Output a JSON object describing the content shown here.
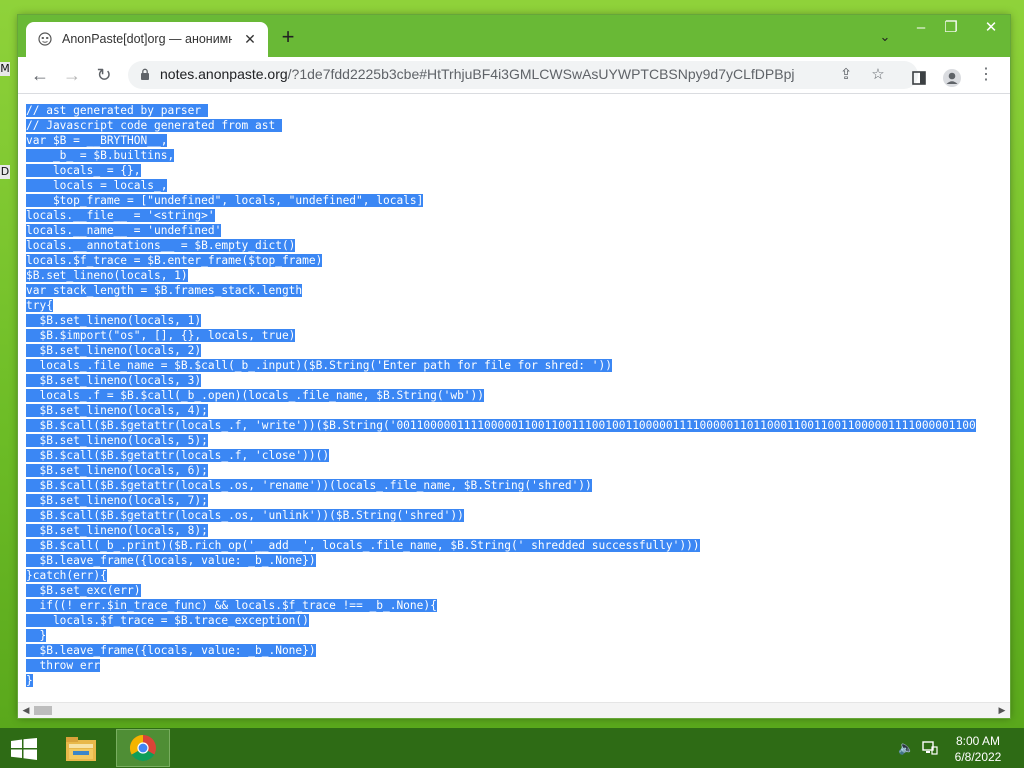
{
  "browser": {
    "tab_title": "AnonPaste[dot]org — анонимн",
    "url_host": "notes.anonpaste.org",
    "url_path": "/?1de7fdd2225b3cbe#HtTrhjuBF4i3GMLCWSwAsUYWPTCBSNpy9d7yCLfDPBpj",
    "icons": {
      "tab_favicon": "anonpaste-mask-icon",
      "tab_close": "close-icon",
      "new_tab": "plus-icon",
      "tab_search": "chevron-down-icon",
      "back": "arrow-left-icon",
      "forward": "arrow-right-icon",
      "reload": "reload-icon",
      "lock": "lock-icon",
      "share": "share-icon",
      "bookmark": "star-icon",
      "side_panel": "side-panel-icon",
      "profile": "profile-icon",
      "menu": "kebab-menu-icon"
    }
  },
  "desktop": {
    "edge_labels": [
      "M",
      "D"
    ]
  },
  "code_lines": [
    "// ast generated by parser ",
    "// Javascript code generated from ast ",
    "var $B = __BRYTHON__,",
    "    _b_ = $B.builtins,",
    "    locals_ = {},",
    "    locals = locals_,",
    "    $top_frame = [\"undefined\", locals, \"undefined\", locals]",
    "locals.__file__ = '<string>'",
    "locals.__name__ = 'undefined'",
    "locals.__annotations__ = $B.empty_dict()",
    "locals.$f_trace = $B.enter_frame($top_frame)",
    "$B.set_lineno(locals, 1)",
    "var stack_length = $B.frames_stack.length",
    "try{",
    "  $B.set_lineno(locals, 1)",
    "  $B.$import(\"os\", [], {}, locals, true)",
    "  $B.set_lineno(locals, 2)",
    "  locals_.file_name = $B.$call(_b_.input)($B.String('Enter path for file for shred: '))",
    "  $B.set_lineno(locals, 3)",
    "  locals_.f = $B.$call(_b_.open)(locals_.file_name, $B.String('wb'))",
    "  $B.set_lineno(locals, 4);",
    "  $B.$call($B.$getattr(locals_.f, 'write'))($B.String('00110000011110000011001100111001001100000111100000110110001100110011000001111000001100",
    "  $B.set_lineno(locals, 5);",
    "  $B.$call($B.$getattr(locals_.f, 'close'))()",
    "  $B.set_lineno(locals, 6);",
    "  $B.$call($B.$getattr(locals_.os, 'rename'))(locals_.file_name, $B.String('shred'))",
    "  $B.set_lineno(locals, 7);",
    "  $B.$call($B.$getattr(locals_.os, 'unlink'))($B.String('shred'))",
    "  $B.set_lineno(locals, 8);",
    "  $B.$call(_b_.print)($B.rich_op('__add__', locals_.file_name, $B.String(' shredded successfully')))",
    "  $B.leave_frame({locals, value: _b_.None})",
    "}catch(err){",
    "  $B.set_exc(err)",
    "  if((! err.$in_trace_func) && locals.$f_trace !== _b_.None){",
    "    locals.$f_trace = $B.trace_exception()",
    "  }",
    "  $B.leave_frame({locals, value: _b_.None})",
    "  throw err",
    "}"
  ],
  "selection_color": "#3b87f4",
  "taskbar": {
    "icons": {
      "start": "windows-start-icon",
      "explorer": "file-explorer-icon",
      "chrome": "chrome-icon",
      "volume": "volume-muted-icon",
      "network": "network-icon"
    },
    "time": "8:00 AM",
    "date": "6/8/2022"
  }
}
